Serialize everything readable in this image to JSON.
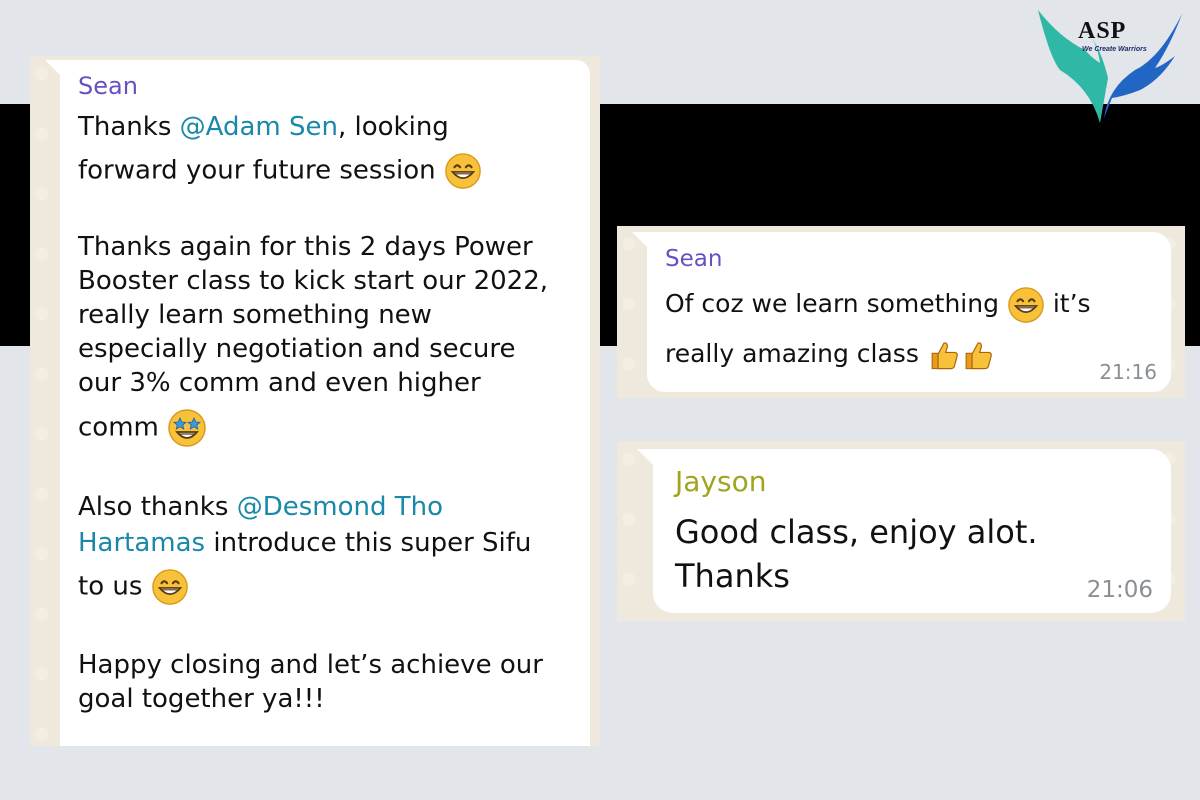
{
  "logo": {
    "text": "ASP",
    "tagline": "We Create Warriors",
    "colors": {
      "left_wing": "#2fb8a6",
      "right_wing": "#2166c4"
    }
  },
  "left_chat": {
    "sender": "Sean",
    "paragraphs": [
      {
        "lines": [
          {
            "before": "Thanks ",
            "mention": "@Adam Sen",
            "after": ", looking"
          },
          {
            "text": "forward your future session",
            "emoji": "grin-icon"
          }
        ]
      },
      {
        "lines": [
          {
            "text": "Thanks again for this 2 days Power"
          },
          {
            "text": "Booster class to kick start our 2022,"
          },
          {
            "text": "really learn something new"
          },
          {
            "text": "especially negotiation and secure"
          },
          {
            "text": "our 3% comm and even higher"
          },
          {
            "text": "comm",
            "emoji": "star-struck-icon"
          }
        ]
      },
      {
        "lines": [
          {
            "before": "Also thanks ",
            "mention": "@Desmond Tho"
          },
          {
            "mention": "Hartamas",
            "after": " introduce this super Sifu"
          },
          {
            "text": "to us",
            "emoji": "grin-icon"
          }
        ]
      },
      {
        "lines": [
          {
            "text": "Happy closing and let’s achieve our"
          },
          {
            "text": "goal together ya!!!"
          }
        ]
      }
    ]
  },
  "right_chat_1": {
    "sender": "Sean",
    "line1": "Of coz we learn something",
    "line1_after": "it’s",
    "line2": "really amazing class",
    "time": "21:16"
  },
  "right_chat_2": {
    "sender": "Jayson",
    "line1": "Good class, enjoy alot.",
    "line2": "Thanks",
    "time": "21:06"
  },
  "colors": {
    "sender_sean": "#6a4fc1",
    "sender_jayson": "#a0a41e",
    "mention": "#1a88a8",
    "timestamp": "#8a8f94"
  }
}
